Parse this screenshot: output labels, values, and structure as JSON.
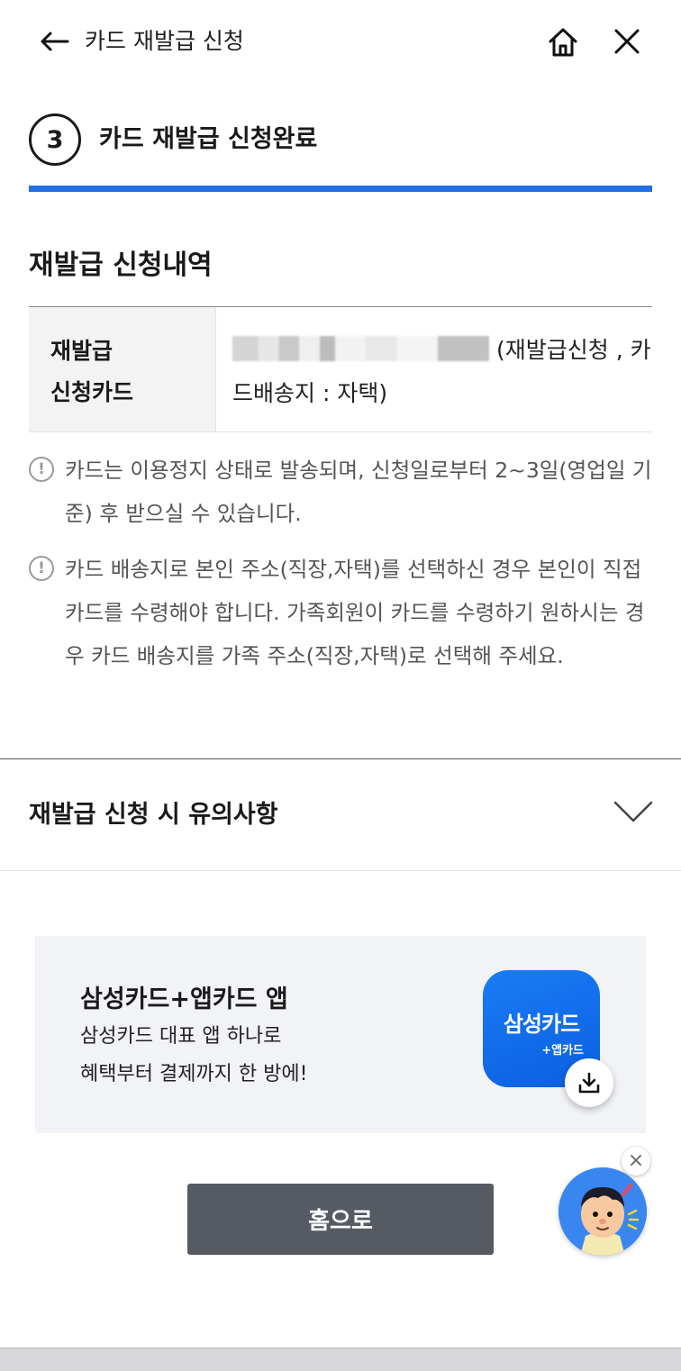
{
  "header": {
    "title": "카드 재발급 신청",
    "back_icon": "arrow-left-icon",
    "home_icon": "home-icon",
    "close_icon": "close-icon"
  },
  "step": {
    "number": "3",
    "title": "카드 재발급 신청완료",
    "progress_color": "#1f6fe5"
  },
  "summary": {
    "section_title": "재발급 신청내역",
    "row_label_line1": "재발급",
    "row_label_line2": "신청카드",
    "row_value": "(재발급신청 , 카드배송지 : 자택)"
  },
  "notices": [
    "카드는 이용정지 상태로 발송되며, 신청일로부터 2~3일(영업일 기준) 후 받으실 수 있습니다.",
    "카드 배송지로 본인 주소(직장,자택)를 선택하신 경우 본인이 직접 카드를 수령해야 합니다. 가족회원이 카드를 수령하기 원하시는 경우 카드 배송지를 가족 주소(직장,자택)로 선택해 주세요."
  ],
  "accordion": {
    "title": "재발급 신청 시 유의사항"
  },
  "app_banner": {
    "title": "삼성카드+앱카드 앱",
    "line1": "삼성카드 대표 앱 하나로",
    "line2": "혜택부터 결제까지 한 방에!",
    "icon_main": "삼성카드",
    "icon_sub": "+앱카드",
    "icon_color": "#1a7cf5"
  },
  "home_button": {
    "label": "홈으로",
    "color": "#555a63"
  },
  "chatbot": {
    "close_label": "×"
  }
}
